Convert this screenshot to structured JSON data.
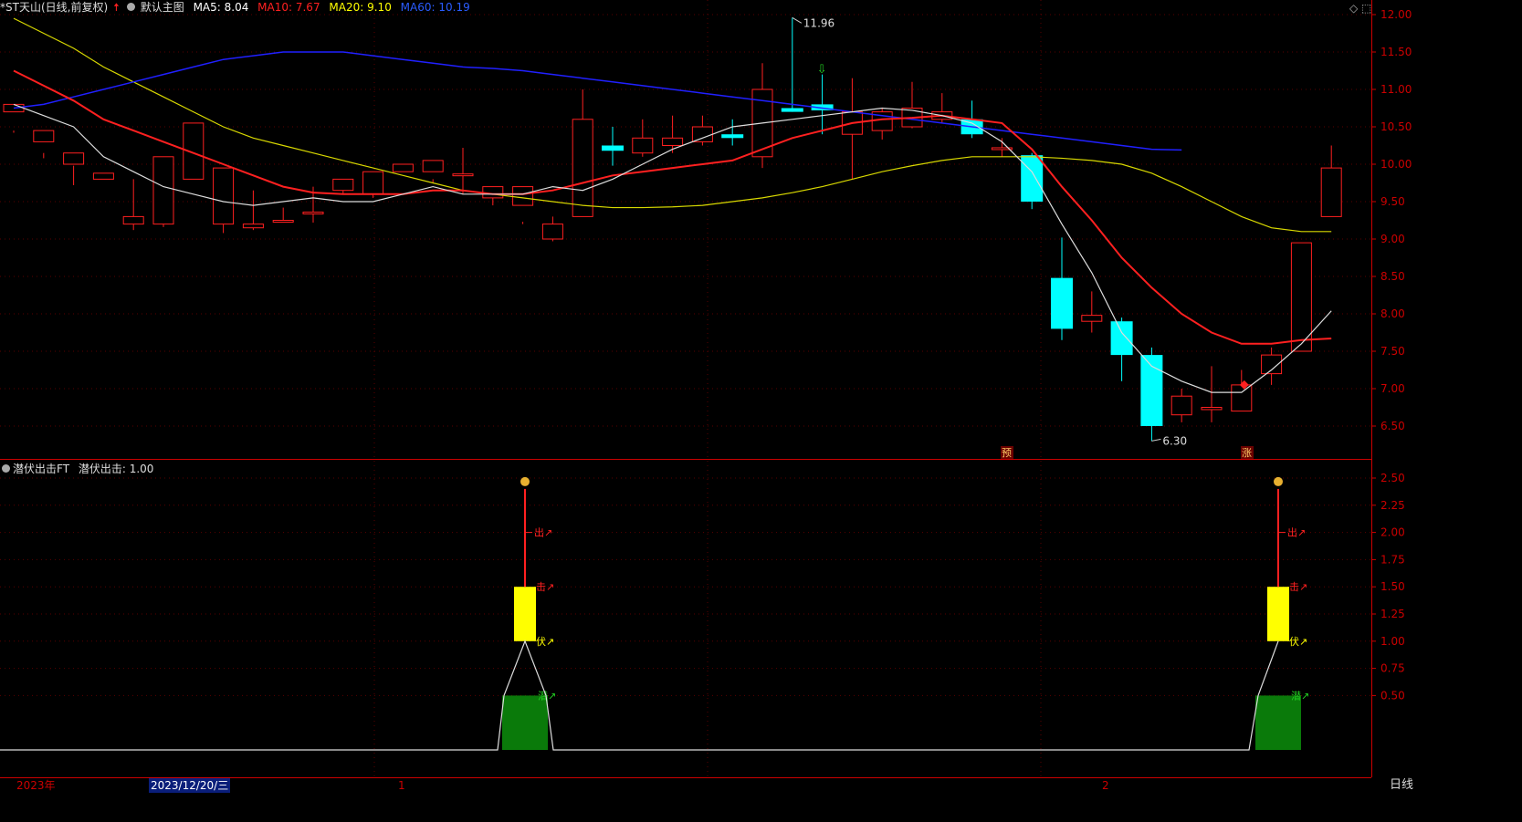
{
  "header": {
    "stock_name": "*ST天山(日线,前复权)",
    "main_chart_label": "默认主图",
    "ma5": {
      "label": "MA5: 8.04",
      "color": "#ffffff"
    },
    "ma10": {
      "label": "MA10: 7.67",
      "color": "#ff2020"
    },
    "ma20": {
      "label": "MA20: 9.10",
      "color": "#ffff00"
    },
    "ma60": {
      "label": "MA60: 10.19",
      "color": "#2020ff"
    }
  },
  "indicator_header": {
    "name": "潜伏出击FT",
    "value_label": "潜伏出击: 1.00"
  },
  "price_axis": [
    "12.00",
    "11.50",
    "11.00",
    "10.50",
    "10.00",
    "9.50",
    "9.00",
    "8.50",
    "8.00",
    "7.50",
    "7.00",
    "6.50"
  ],
  "indicator_axis": [
    "2.50",
    "2.25",
    "2.00",
    "1.75",
    "1.50",
    "1.25",
    "1.00",
    "0.75",
    "0.50"
  ],
  "annotations": {
    "high": "11.96",
    "low": "6.30",
    "tag_pre": "预",
    "tag_up": "涨"
  },
  "signal_labels": {
    "out": "出↗",
    "strike": "击↗",
    "hide": "伏↗",
    "latent": "潜↗"
  },
  "bottom_bar": {
    "year": "2023年",
    "selected_date": "2023/12/20/三",
    "month_1": "1",
    "month_2": "2",
    "period": "日线"
  },
  "colors": {
    "up": "#ff2020",
    "down": "#00ffff",
    "axis": "#cc0000"
  },
  "chart_data": {
    "type": "candlestick",
    "ohlc": [
      [
        10.7,
        10.8,
        10.45,
        10.42
      ],
      [
        10.3,
        10.45,
        10.15,
        10.08
      ],
      [
        10.0,
        10.15,
        9.98,
        9.72
      ],
      [
        9.8,
        9.88,
        9.6,
        9.6
      ],
      [
        9.2,
        9.3,
        9.8,
        9.12
      ],
      [
        9.2,
        10.1,
        9.5,
        9.16
      ],
      [
        9.8,
        10.55,
        9.75,
        9.75
      ],
      [
        9.2,
        9.95,
        9.65,
        9.08
      ],
      [
        9.15,
        9.2,
        9.65,
        9.12
      ],
      [
        9.25,
        9.25,
        9.42,
        9.22
      ],
      [
        9.35,
        9.36,
        9.7,
        9.22
      ],
      [
        9.65,
        9.8,
        9.7,
        9.6
      ],
      [
        9.6,
        9.9,
        9.65,
        9.55
      ],
      [
        9.9,
        10.0,
        9.75,
        9.75
      ],
      [
        9.9,
        10.05,
        9.8,
        9.75
      ],
      [
        9.85,
        9.87,
        10.22,
        9.6
      ],
      [
        9.55,
        9.7,
        9.58,
        9.45
      ],
      [
        9.45,
        9.7,
        9.23,
        9.2
      ],
      [
        9.0,
        9.2,
        9.3,
        8.97
      ],
      [
        9.3,
        10.6,
        11.0,
        9.3
      ],
      [
        10.25,
        10.18,
        10.5,
        9.98
      ],
      [
        10.15,
        10.35,
        10.6,
        10.1
      ],
      [
        10.25,
        10.35,
        10.65,
        10.15
      ],
      [
        10.3,
        10.5,
        10.65,
        10.25
      ],
      [
        10.4,
        10.35,
        10.6,
        10.25
      ],
      [
        10.1,
        11.0,
        11.35,
        9.95
      ],
      [
        10.75,
        10.7,
        11.96,
        10.7
      ],
      [
        10.8,
        10.72,
        11.2,
        10.4
      ],
      [
        10.4,
        10.7,
        11.15,
        9.8
      ],
      [
        10.45,
        10.7,
        10.75,
        10.33
      ],
      [
        10.5,
        10.75,
        11.1,
        10.48
      ],
      [
        10.6,
        10.7,
        10.95,
        10.55
      ],
      [
        10.6,
        10.4,
        10.85,
        10.35
      ],
      [
        10.2,
        10.22,
        10.35,
        10.1
      ],
      [
        10.12,
        9.5,
        10.15,
        9.4
      ],
      [
        8.48,
        7.8,
        9.02,
        7.65
      ],
      [
        7.9,
        7.98,
        8.3,
        7.75
      ],
      [
        7.9,
        7.45,
        7.95,
        7.1
      ],
      [
        7.45,
        6.5,
        7.55,
        6.3
      ],
      [
        6.65,
        6.9,
        7.0,
        6.55
      ],
      [
        6.72,
        6.75,
        7.3,
        6.55
      ],
      [
        6.7,
        7.05,
        7.25,
        6.7
      ],
      [
        7.2,
        7.45,
        7.55,
        7.05
      ],
      [
        7.5,
        8.95,
        8.95,
        7.5
      ],
      [
        9.3,
        9.95,
        10.25,
        9.3
      ]
    ],
    "ma5": [
      10.8,
      10.65,
      10.5,
      10.1,
      9.9,
      9.7,
      9.6,
      9.5,
      9.45,
      9.5,
      9.55,
      9.5,
      9.5,
      9.6,
      9.7,
      9.6,
      9.6,
      9.6,
      9.7,
      9.65,
      9.8,
      10.0,
      10.2,
      10.35,
      10.5,
      10.55,
      10.6,
      10.65,
      10.7,
      10.75,
      10.72,
      10.65,
      10.55,
      10.3,
      9.9,
      9.2,
      8.55,
      7.75,
      7.3,
      7.1,
      6.95,
      6.95,
      7.25,
      7.6,
      8.04
    ],
    "ma10": [
      11.25,
      11.05,
      10.85,
      10.6,
      10.45,
      10.3,
      10.15,
      10.0,
      9.85,
      9.7,
      9.62,
      9.6,
      9.6,
      9.6,
      9.65,
      9.65,
      9.6,
      9.6,
      9.65,
      9.75,
      9.85,
      9.9,
      9.95,
      10.0,
      10.05,
      10.2,
      10.35,
      10.45,
      10.55,
      10.6,
      10.62,
      10.65,
      10.6,
      10.55,
      10.2,
      9.7,
      9.25,
      8.75,
      8.35,
      8.0,
      7.75,
      7.6,
      7.6,
      7.65,
      7.67
    ],
    "ma20": [
      11.95,
      11.75,
      11.55,
      11.3,
      11.1,
      10.9,
      10.7,
      10.5,
      10.35,
      10.25,
      10.15,
      10.05,
      9.95,
      9.85,
      9.75,
      9.65,
      9.6,
      9.55,
      9.5,
      9.45,
      9.42,
      9.42,
      9.43,
      9.45,
      9.5,
      9.55,
      9.62,
      9.7,
      9.8,
      9.9,
      9.98,
      10.05,
      10.1,
      10.1,
      10.1,
      10.08,
      10.05,
      10.0,
      9.88,
      9.7,
      9.5,
      9.3,
      9.15,
      9.1,
      9.1
    ],
    "ma60": [
      10.75,
      10.8,
      10.9,
      11.0,
      11.1,
      11.2,
      11.3,
      11.4,
      11.45,
      11.5,
      11.5,
      11.5,
      11.45,
      11.4,
      11.35,
      11.3,
      11.28,
      11.25,
      11.2,
      11.15,
      11.1,
      11.05,
      11.0,
      10.95,
      10.9,
      10.85,
      10.8,
      10.75,
      10.7,
      10.65,
      10.6,
      10.55,
      10.5,
      10.45,
      10.4,
      10.35,
      10.3,
      10.25,
      10.2,
      10.19
    ],
    "indicator": {
      "baseline": 0.0,
      "signal_index_1": 17,
      "signal_index_2": 43,
      "green_bar_value": 0.5,
      "yellow_bar_range": [
        1.0,
        1.5
      ],
      "red_line_top": 2.4
    }
  }
}
